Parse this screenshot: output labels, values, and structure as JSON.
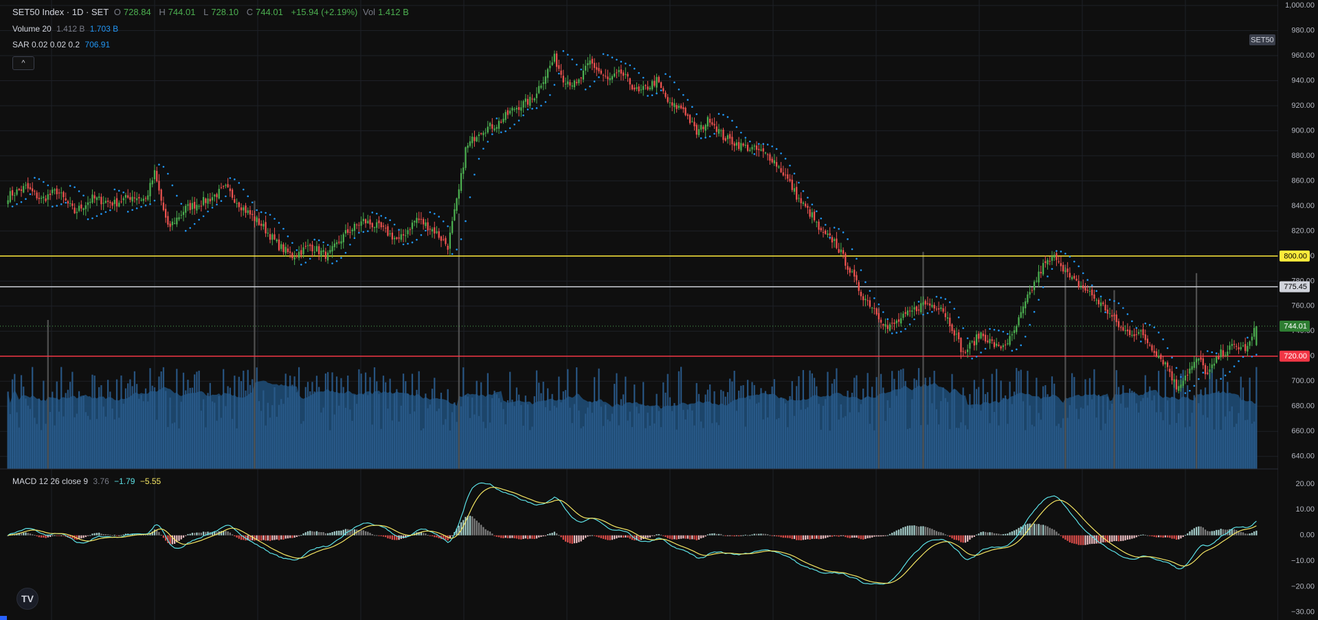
{
  "header": {
    "title": "SET50 Index · 1D · SET",
    "o_label": "O",
    "o_value": "728.84",
    "h_label": "H",
    "h_value": "744.01",
    "l_label": "L",
    "l_value": "728.10",
    "c_label": "C",
    "c_value": "744.01",
    "change": "+15.94 (+2.19%)",
    "vol_label": "Vol",
    "vol_value": "1.412 B"
  },
  "volume_legend": {
    "label": "Volume 20",
    "value": "1.412 B",
    "ma": "1.703 B"
  },
  "sar_legend": {
    "label": "SAR 0.02 0.02 0.2",
    "value": "706.91"
  },
  "macd_legend": {
    "label": "MACD 12 26 close 9",
    "hist": "3.76",
    "macd": "−1.79",
    "signal": "−5.55"
  },
  "symbol_badge": "SET50",
  "colors": {
    "background": "#0f0f0f",
    "grid": "#1e2027",
    "up": "#4caf50",
    "down": "#ef5350",
    "sar": "#2196f3",
    "volume": "#2a5b8c",
    "volume_ma": "#2e6aa0",
    "macd": "#5ce1e6",
    "signal": "#f5e663",
    "support_yellow": "#ffeb3b",
    "support_white": "#d1d4dc",
    "support_red": "#f23645"
  },
  "icons": {
    "collapse": "chevron-up-icon",
    "logo": "tradingview-logo-icon"
  },
  "chart_data": {
    "type": "candlestick",
    "price_axis": {
      "ticks": [
        "1,000.00",
        "980.00",
        "960.00",
        "940.00",
        "920.00",
        "900.00",
        "880.00",
        "860.00",
        "840.00",
        "820.00",
        "800.00",
        "780.00",
        "760.00",
        "740.00",
        "720.00",
        "700.00",
        "680.00",
        "660.00",
        "640.00"
      ],
      "ylim": [
        630,
        1000
      ]
    },
    "macd_axis": {
      "ticks": [
        "20.00",
        "10.00",
        "0.00",
        "−10.00",
        "−20.00",
        "−30.00"
      ],
      "ylim": [
        -33,
        24
      ]
    },
    "horizontal_lines": [
      {
        "value": 800.0,
        "label": "800.00",
        "color": "#ffeb3b"
      },
      {
        "value": 775.45,
        "label": "775.45",
        "color": "#d1d4dc"
      },
      {
        "value": 720.0,
        "label": "720.00",
        "color": "#f23645"
      }
    ],
    "last_price": {
      "value": 744.01,
      "label": "744.01"
    },
    "anchors": [
      [
        0,
        848
      ],
      [
        8,
        855
      ],
      [
        15,
        845
      ],
      [
        22,
        852
      ],
      [
        30,
        835
      ],
      [
        38,
        846
      ],
      [
        48,
        842
      ],
      [
        56,
        848
      ],
      [
        62,
        845
      ],
      [
        66,
        866
      ],
      [
        72,
        822
      ],
      [
        80,
        838
      ],
      [
        90,
        845
      ],
      [
        98,
        854
      ],
      [
        106,
        838
      ],
      [
        114,
        825
      ],
      [
        122,
        808
      ],
      [
        128,
        800
      ],
      [
        136,
        808
      ],
      [
        144,
        800
      ],
      [
        152,
        818
      ],
      [
        160,
        828
      ],
      [
        168,
        822
      ],
      [
        176,
        812
      ],
      [
        184,
        830
      ],
      [
        192,
        820
      ],
      [
        198,
        808
      ],
      [
        203,
        852
      ],
      [
        206,
        885
      ],
      [
        212,
        900
      ],
      [
        220,
        905
      ],
      [
        228,
        918
      ],
      [
        236,
        925
      ],
      [
        242,
        945
      ],
      [
        246,
        958
      ],
      [
        250,
        942
      ],
      [
        256,
        936
      ],
      [
        262,
        955
      ],
      [
        270,
        940
      ],
      [
        276,
        946
      ],
      [
        284,
        930
      ],
      [
        292,
        940
      ],
      [
        298,
        920
      ],
      [
        304,
        918
      ],
      [
        310,
        898
      ],
      [
        316,
        910
      ],
      [
        322,
        895
      ],
      [
        330,
        888
      ],
      [
        338,
        884
      ],
      [
        344,
        878
      ],
      [
        350,
        864
      ],
      [
        356,
        845
      ],
      [
        362,
        832
      ],
      [
        366,
        818
      ],
      [
        372,
        812
      ],
      [
        378,
        792
      ],
      [
        384,
        770
      ],
      [
        390,
        758
      ],
      [
        396,
        742
      ],
      [
        404,
        752
      ],
      [
        412,
        762
      ],
      [
        420,
        760
      ],
      [
        426,
        740
      ],
      [
        430,
        722
      ],
      [
        438,
        738
      ],
      [
        446,
        726
      ],
      [
        452,
        735
      ],
      [
        458,
        762
      ],
      [
        462,
        778
      ],
      [
        466,
        792
      ],
      [
        472,
        800
      ],
      [
        478,
        782
      ],
      [
        486,
        772
      ],
      [
        494,
        758
      ],
      [
        502,
        740
      ],
      [
        510,
        738
      ],
      [
        516,
        725
      ],
      [
        522,
        712
      ],
      [
        526,
        695
      ],
      [
        530,
        705
      ],
      [
        536,
        718
      ],
      [
        540,
        705
      ],
      [
        546,
        722
      ],
      [
        552,
        728
      ],
      [
        558,
        726
      ],
      [
        562,
        744
      ]
    ],
    "n_bars": 563,
    "volume": {
      "base_range": [
        0.9,
        2.4
      ],
      "spikes": [
        [
          111,
          6.3
        ],
        [
          203,
          6.0
        ],
        [
          412,
          5.1
        ],
        [
          476,
          4.8
        ],
        [
          535,
          4.6
        ],
        [
          498,
          4.2
        ],
        [
          392,
          3.8
        ],
        [
          18,
          3.5
        ]
      ],
      "ma_range": [
        1.3,
        2.0
      ]
    }
  }
}
